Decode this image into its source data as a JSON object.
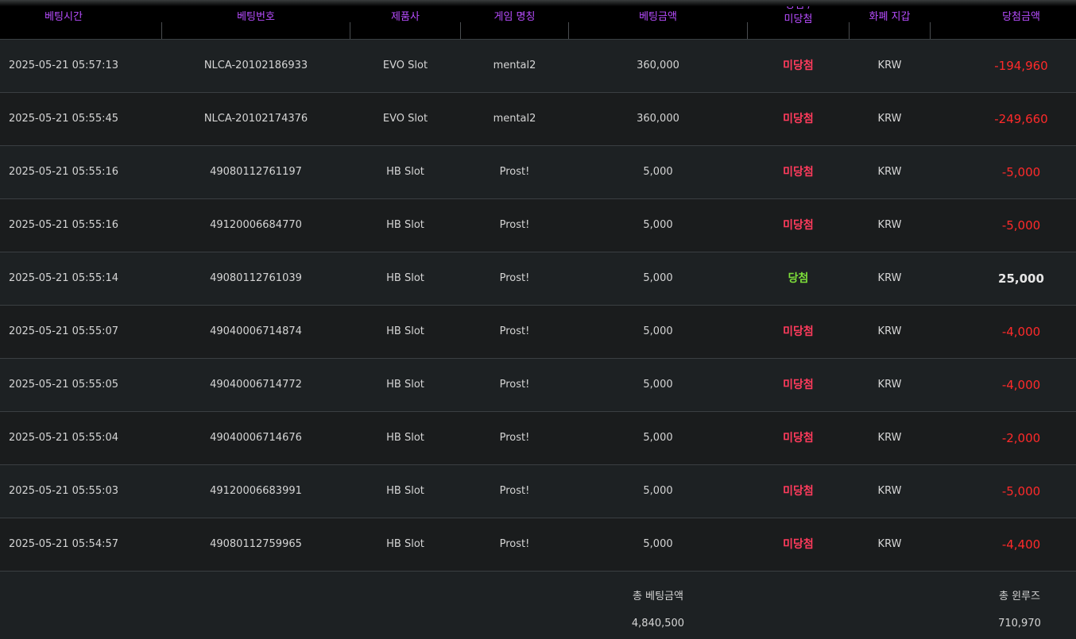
{
  "headers": {
    "time": "베팅시간",
    "number": "베팅번호",
    "provider": "제품사",
    "game": "게임 명칭",
    "bet": "베팅금액",
    "result_line1": "당첨 /",
    "result_line2": "미당첨",
    "currency": "화폐 지갑",
    "win": "당첨금액"
  },
  "colors": {
    "header_text": "#b84dff",
    "lose": "#ff3b5c",
    "win": "#7dde3a",
    "negative_amount": "#ff2a2a"
  },
  "rows": [
    {
      "time": "2025-05-21 05:57:13",
      "number": "NLCA-20102186933",
      "provider": "EVO Slot",
      "game": "mental2",
      "bet": "360,000",
      "result": "미당첨",
      "result_type": "lose",
      "currency": "KRW",
      "win": "-194,960",
      "win_sign": "neg"
    },
    {
      "time": "2025-05-21 05:55:45",
      "number": "NLCA-20102174376",
      "provider": "EVO Slot",
      "game": "mental2",
      "bet": "360,000",
      "result": "미당첨",
      "result_type": "lose",
      "currency": "KRW",
      "win": "-249,660",
      "win_sign": "neg"
    },
    {
      "time": "2025-05-21 05:55:16",
      "number": "49080112761197",
      "provider": "HB Slot",
      "game": "Prost!",
      "bet": "5,000",
      "result": "미당첨",
      "result_type": "lose",
      "currency": "KRW",
      "win": "-5,000",
      "win_sign": "neg"
    },
    {
      "time": "2025-05-21 05:55:16",
      "number": "49120006684770",
      "provider": "HB Slot",
      "game": "Prost!",
      "bet": "5,000",
      "result": "미당첨",
      "result_type": "lose",
      "currency": "KRW",
      "win": "-5,000",
      "win_sign": "neg"
    },
    {
      "time": "2025-05-21 05:55:14",
      "number": "49080112761039",
      "provider": "HB Slot",
      "game": "Prost!",
      "bet": "5,000",
      "result": "당첨",
      "result_type": "win",
      "currency": "KRW",
      "win": "25,000",
      "win_sign": "pos"
    },
    {
      "time": "2025-05-21 05:55:07",
      "number": "49040006714874",
      "provider": "HB Slot",
      "game": "Prost!",
      "bet": "5,000",
      "result": "미당첨",
      "result_type": "lose",
      "currency": "KRW",
      "win": "-4,000",
      "win_sign": "neg"
    },
    {
      "time": "2025-05-21 05:55:05",
      "number": "49040006714772",
      "provider": "HB Slot",
      "game": "Prost!",
      "bet": "5,000",
      "result": "미당첨",
      "result_type": "lose",
      "currency": "KRW",
      "win": "-4,000",
      "win_sign": "neg"
    },
    {
      "time": "2025-05-21 05:55:04",
      "number": "49040006714676",
      "provider": "HB Slot",
      "game": "Prost!",
      "bet": "5,000",
      "result": "미당첨",
      "result_type": "lose",
      "currency": "KRW",
      "win": "-2,000",
      "win_sign": "neg"
    },
    {
      "time": "2025-05-21 05:55:03",
      "number": "49120006683991",
      "provider": "HB Slot",
      "game": "Prost!",
      "bet": "5,000",
      "result": "미당첨",
      "result_type": "lose",
      "currency": "KRW",
      "win": "-5,000",
      "win_sign": "neg"
    },
    {
      "time": "2025-05-21 05:54:57",
      "number": "49080112759965",
      "provider": "HB Slot",
      "game": "Prost!",
      "bet": "5,000",
      "result": "미당첨",
      "result_type": "lose",
      "currency": "KRW",
      "win": "-4,400",
      "win_sign": "neg"
    }
  ],
  "footer": {
    "total_bet_label": "총 베팅금액",
    "total_bet_value": "4,840,500",
    "total_winloss_label": "총 윈루즈",
    "total_winloss_value": "710,970"
  }
}
